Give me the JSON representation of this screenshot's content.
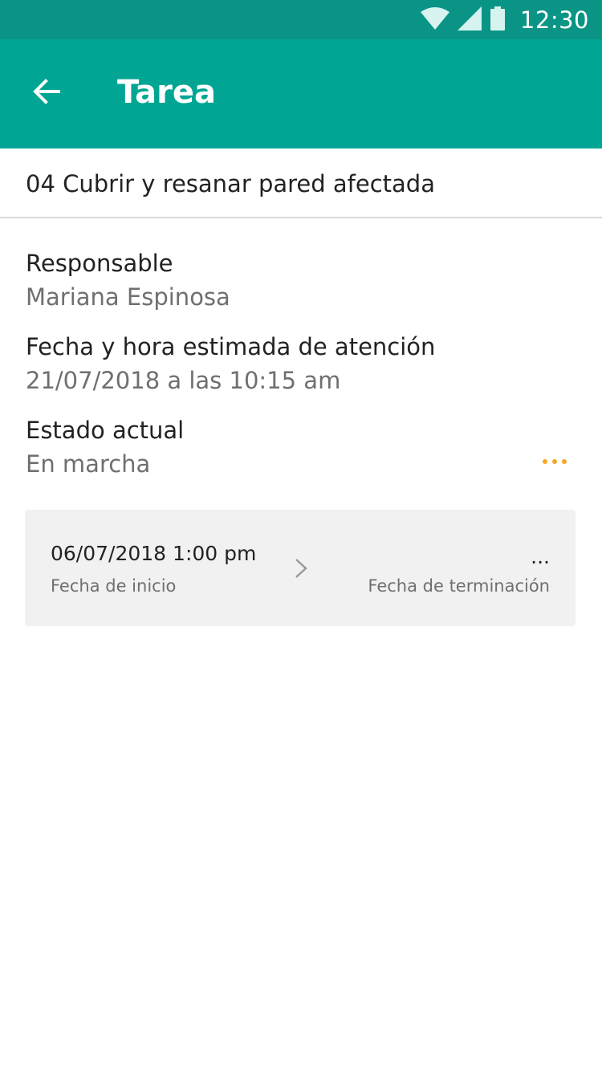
{
  "status_bar": {
    "time": "12:30",
    "icons": [
      "wifi-icon",
      "signal-icon",
      "battery-icon"
    ]
  },
  "app_bar": {
    "title": "Tarea",
    "back_icon": "arrow-back-icon"
  },
  "task": {
    "title": "04 Cubrir y resanar pared afectada"
  },
  "fields": {
    "responsable_label": "Responsable",
    "responsable_value": "Mariana Espinosa",
    "fecha_label": "Fecha y hora estimada de atención",
    "fecha_value": "21/07/2018 a las 10:15 am",
    "estado_label": "Estado actual",
    "estado_value": "En marcha"
  },
  "dates_card": {
    "start_value": "06/07/2018 1:00 pm",
    "start_label": "Fecha de inicio",
    "end_value": "...",
    "end_label": "Fecha de terminación"
  },
  "colors": {
    "status_bar": "#0a9486",
    "app_bar": "#00a693",
    "accent": "#f5a623",
    "card_bg": "#f1f1f1"
  }
}
